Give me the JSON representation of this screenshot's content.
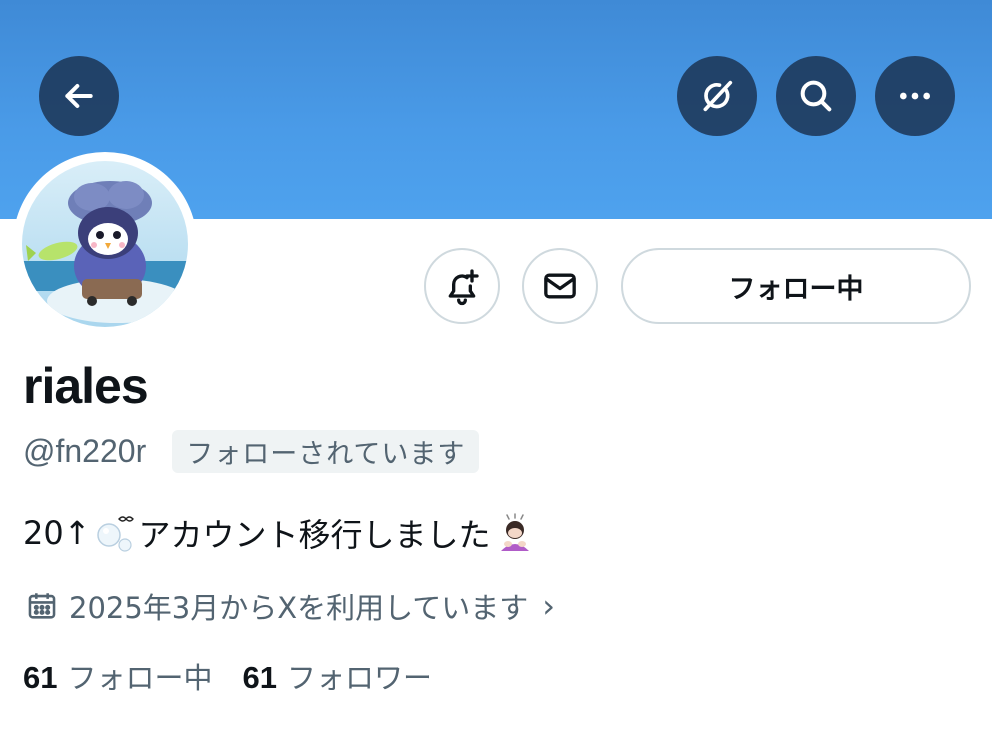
{
  "header": {
    "back_icon": "arrow-left-icon",
    "grok_icon": "grok-slash-icon",
    "search_icon": "search-icon",
    "more_icon": "more-horizontal-icon",
    "banner_color": "#4a9be8"
  },
  "actions": {
    "notify_icon": "bell-plus-icon",
    "dm_icon": "envelope-icon",
    "following_label": "フォロー中"
  },
  "profile": {
    "name": "riales",
    "handle": "@fn220r",
    "follows_you_badge": "フォローされています",
    "bio_start": "20↑",
    "bio_text": "アカウント移行しました",
    "joined": "2025年3月からXを利用しています",
    "joined_chevron": "›"
  },
  "stats": {
    "following_count": "61",
    "following_label": "フォロー中",
    "followers_count": "61",
    "followers_label": "フォロワー"
  }
}
